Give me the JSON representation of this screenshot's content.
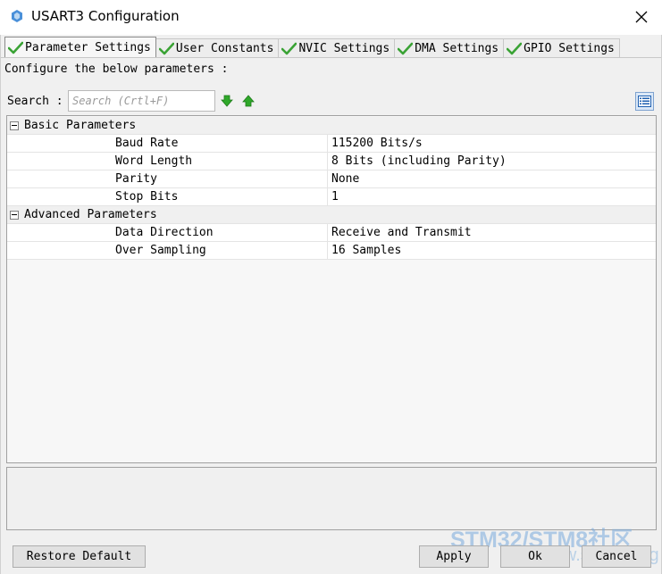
{
  "window": {
    "title": "USART3 Configuration"
  },
  "tabs": [
    {
      "label": "Parameter Settings",
      "active": true
    },
    {
      "label": "User Constants",
      "active": false
    },
    {
      "label": "NVIC Settings",
      "active": false
    },
    {
      "label": "DMA Settings",
      "active": false
    },
    {
      "label": "GPIO Settings",
      "active": false
    }
  ],
  "instructions": "Configure the below parameters :",
  "search": {
    "label": "Search :",
    "placeholder": "Search (Crtl+F)",
    "value": ""
  },
  "groups": [
    {
      "label": "Basic Parameters",
      "params": [
        {
          "name": "Baud Rate",
          "value": "115200 Bits/s"
        },
        {
          "name": "Word Length",
          "value": "8 Bits (including Parity)"
        },
        {
          "name": "Parity",
          "value": "None"
        },
        {
          "name": "Stop Bits",
          "value": "1"
        }
      ]
    },
    {
      "label": "Advanced Parameters",
      "params": [
        {
          "name": "Data Direction",
          "value": "Receive and Transmit"
        },
        {
          "name": "Over Sampling",
          "value": "16 Samples"
        }
      ]
    }
  ],
  "buttons": {
    "restore_default": "Restore Default",
    "apply": "Apply",
    "ok": "Ok",
    "cancel": "Cancel"
  },
  "watermark": {
    "line1": "STM32/STM8社区",
    "line2": "www.stmcu.org"
  },
  "colors": {
    "check_green": "#3aa335",
    "arrow_green": "#2fa82a",
    "view_btn_blue": "#1d5fb0"
  },
  "icons": {
    "app": "cube-icon",
    "close": "close-icon",
    "tab_check": "green-check-icon",
    "next": "arrow-down-icon",
    "previous": "arrow-up-icon",
    "view_toggle": "list-view-icon"
  }
}
